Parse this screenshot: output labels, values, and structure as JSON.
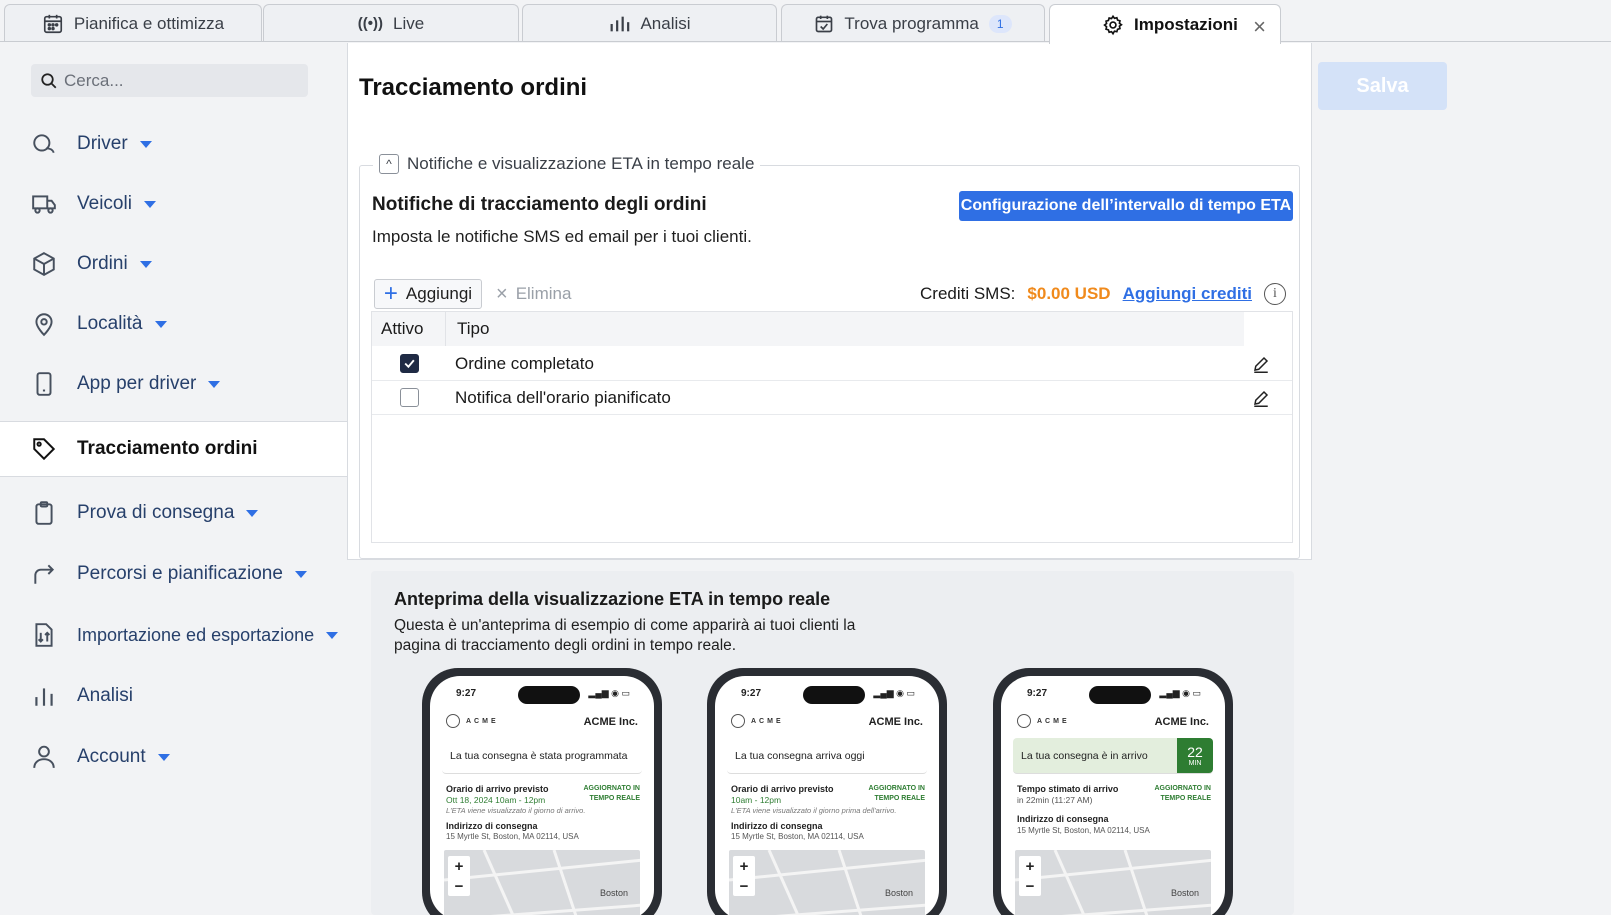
{
  "tabs": [
    {
      "label": "Pianifica e ottimizza",
      "icon": "calendar-grid-icon"
    },
    {
      "label": "Live",
      "icon": "broadcast-icon"
    },
    {
      "label": "Analisi",
      "icon": "bar-chart-icon"
    },
    {
      "label": "Trova programma",
      "icon": "calendar-check-icon",
      "badge": "1"
    },
    {
      "label": "Impostazioni",
      "icon": "gear-icon",
      "active": true
    }
  ],
  "sidebar": {
    "search_placeholder": "Cerca...",
    "items": [
      {
        "label": "Driver",
        "icon": "driver-icon"
      },
      {
        "label": "Veicoli",
        "icon": "truck-icon"
      },
      {
        "label": "Ordini",
        "icon": "package-icon"
      },
      {
        "label": "Località",
        "icon": "map-pin-icon"
      },
      {
        "label": "App per driver",
        "icon": "smartphone-icon"
      },
      {
        "label": "Tracciamento ordini",
        "icon": "tag-icon"
      },
      {
        "label": "Prova di consegna",
        "icon": "clipboard-icon"
      },
      {
        "label": "Percorsi e pianificazione",
        "icon": "route-arrow-icon"
      },
      {
        "label": "Importazione ed esportazione",
        "icon": "import-export-icon"
      },
      {
        "label": "Analisi",
        "icon": "bar-chart-icon"
      },
      {
        "label": "Account",
        "icon": "user-icon"
      }
    ]
  },
  "header": {
    "save_label": "Salva"
  },
  "main": {
    "title": "Tracciamento ordini",
    "section_legend": "Notifiche e visualizzazione ETA in tempo reale",
    "heading": "Notifiche di tracciamento degli ordini",
    "subheading": "Imposta le notifiche SMS ed email per i tuoi clienti.",
    "eta_button": "Configurazione dell’intervallo di tempo ETA",
    "add_label": "Aggiungi",
    "delete_label": "Elimina",
    "credits_label": "Crediti SMS:",
    "credits_value": "$0.00 USD",
    "add_credits_label": "Aggiungi crediti",
    "table": {
      "columns": [
        "Attivo",
        "Tipo"
      ],
      "rows": [
        {
          "active": true,
          "type": "Ordine completato"
        },
        {
          "active": false,
          "type": "Notifica dell'orario pianificato"
        }
      ]
    }
  },
  "preview": {
    "title": "Anteprima della visualizzazione ETA in tempo reale",
    "description": "Questa è un'anteprima di esempio di come apparirà ai tuoi clienti la pagina di tracciamento degli ordini in tempo reale.",
    "phones": [
      {
        "time": "9:27",
        "logo": "ACME",
        "company": "ACME Inc.",
        "status": "La tua consegna è stata programmata",
        "arrival_label": "Orario di arrivo previsto",
        "arrival_value": "Ott 18, 2024 10am - 12pm",
        "updated": "AGGIORNATO IN TEMPO REALE",
        "note": "L'ETA viene visualizzato il giorno di arrivo.",
        "address_label": "Indirizzo di consegna",
        "address": "15 Myrtle St, Boston, MA 02114, USA",
        "city": "Boston"
      },
      {
        "time": "9:27",
        "logo": "ACME",
        "company": "ACME Inc.",
        "status": "La tua consegna arriva oggi",
        "arrival_label": "Orario di arrivo previsto",
        "arrival_value": "10am - 12pm",
        "updated": "AGGIORNATO IN TEMPO REALE",
        "note": "L'ETA viene visualizzato il giorno prima dell'arrivo.",
        "address_label": "Indirizzo di consegna",
        "address": "15 Myrtle St, Boston, MA 02114, USA",
        "city": "Boston"
      },
      {
        "time": "9:27",
        "logo": "ACME",
        "company": "ACME Inc.",
        "status": "La tua consegna è in arrivo",
        "minutes": "22",
        "minutes_unit": "MIN",
        "arrival_label": "Tempo stimato di arrivo",
        "arrival_value": "in 22min (11:27 AM)",
        "updated": "AGGIORNATO IN TEMPO REALE",
        "note": "",
        "address_label": "Indirizzo di consegna",
        "address": "15 Myrtle St, Boston, MA 02114, USA",
        "city": "Boston"
      }
    ]
  },
  "colors": {
    "accent": "#2f6fe4",
    "credits": "#f08a1c",
    "save_disabled": "#d4e2f8"
  }
}
